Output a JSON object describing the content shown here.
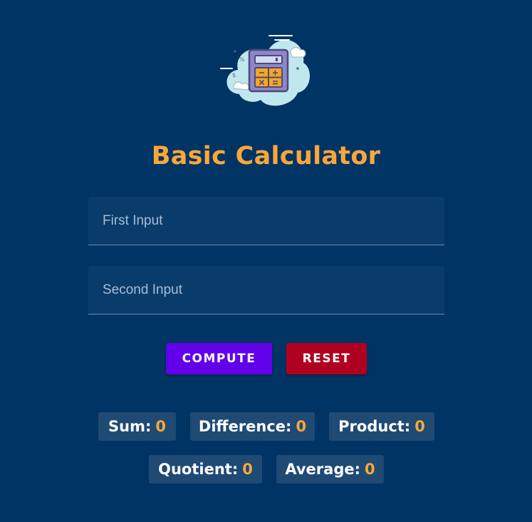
{
  "app": {
    "title": "Basic Calculator",
    "logo_icon": "calculator-cloud-icon"
  },
  "inputs": {
    "first": {
      "placeholder": "First Input",
      "value": ""
    },
    "second": {
      "placeholder": "Second Input",
      "value": ""
    }
  },
  "buttons": {
    "compute_label": "COMPUTE",
    "reset_label": "RESET"
  },
  "results": [
    {
      "label": "Sum:",
      "value": "0"
    },
    {
      "label": "Difference:",
      "value": "0"
    },
    {
      "label": "Product:",
      "value": "0"
    },
    {
      "label": "Quotient:",
      "value": "0"
    },
    {
      "label": "Average:",
      "value": "0"
    }
  ],
  "colors": {
    "background": "#003464",
    "accent": "#f9a73a",
    "compute": "#6200ea",
    "reset": "#b00020",
    "chip": "#1e4a74"
  }
}
